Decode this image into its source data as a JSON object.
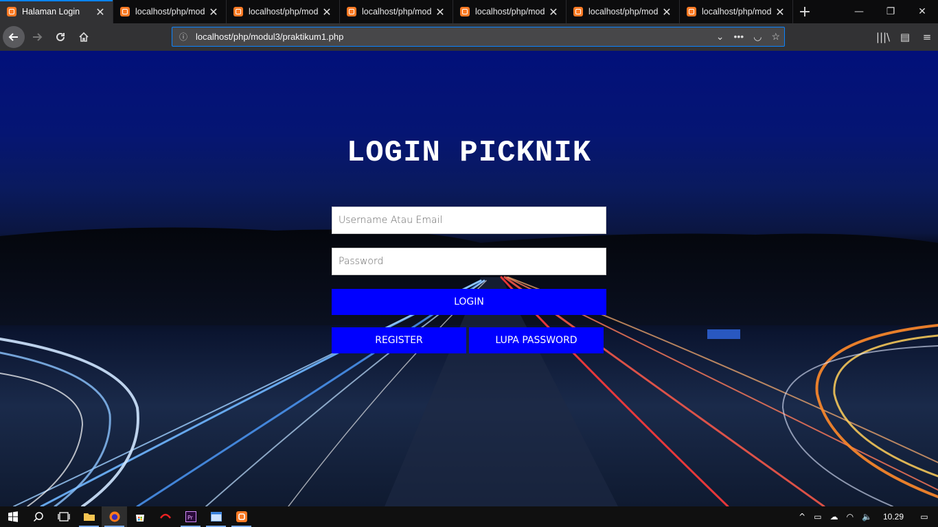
{
  "browser": {
    "tabs": [
      {
        "title": "Halaman Login",
        "active": true
      },
      {
        "title": "localhost/php/mod",
        "active": false
      },
      {
        "title": "localhost/php/mod",
        "active": false
      },
      {
        "title": "localhost/php/mod",
        "active": false
      },
      {
        "title": "localhost/php/mod",
        "active": false
      },
      {
        "title": "localhost/php/mod",
        "active": false
      },
      {
        "title": "localhost/php/mod",
        "active": false
      }
    ],
    "url": "localhost/php/modul3/praktikum1.php"
  },
  "login": {
    "heading": "LOGIN PICKNIK",
    "username_placeholder": "Username Atau Email",
    "password_placeholder": "Password",
    "login_label": "LOGIN",
    "register_label": "REGISTER",
    "forgot_label": "LUPA PASSWORD"
  },
  "taskbar": {
    "clock": "10.29"
  },
  "colors": {
    "button": "#0000ff",
    "tab_accent": "#0a84ff"
  }
}
